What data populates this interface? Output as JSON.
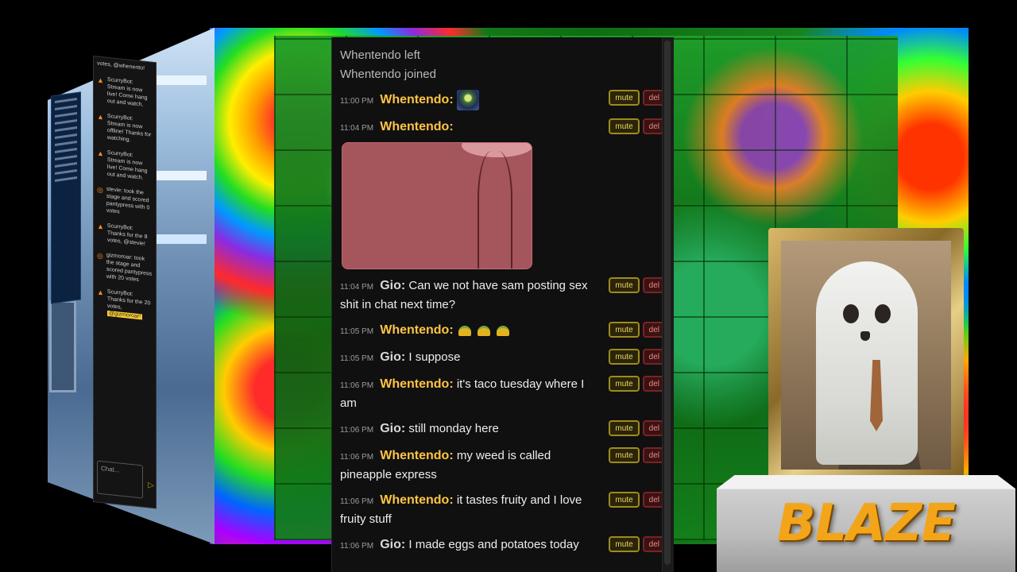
{
  "left_chat": {
    "items": [
      {
        "text": "votes, @whenento!"
      },
      {
        "text": "ScurryBot: Stream is now live! Come hang out and watch."
      },
      {
        "text": "ScurryBot: Stream is now offline! Thanks for watching."
      },
      {
        "text": "ScurryBot: Stream is now live! Come hang out and watch."
      },
      {
        "text": "stevie: took the stage and scored pantypress with 0 votes"
      },
      {
        "text": "ScurryBot: Thanks for the 8 votes, @stevie!"
      },
      {
        "text": "gizmoroar: took the stage and scored pantypress with 20 votes"
      },
      {
        "text": "ScurryBot: Thanks for the 20 votes,",
        "highlight": "@gizmoroar!"
      }
    ],
    "input_placeholder": "Chat..."
  },
  "chat": {
    "system_messages": [
      "Whentendo left",
      "Whentendo joined"
    ],
    "messages": [
      {
        "time": "11:00 PM",
        "user": "Whentendo:",
        "text": "",
        "emote": "emote-icon"
      },
      {
        "time": "11:04 PM",
        "user": "Whentendo:",
        "text": "",
        "image": "shared-image"
      },
      {
        "time": "11:04 PM",
        "user": "Gio:",
        "text": "Can we not have sam posting sex shit in chat next time?"
      },
      {
        "time": "11:05 PM",
        "user": "Whentendo:",
        "text": "",
        "tacos": 3
      },
      {
        "time": "11:05 PM",
        "user": "Gio:",
        "text": "I suppose"
      },
      {
        "time": "11:06 PM",
        "user": "Whentendo:",
        "text": "it's taco tuesday where I am"
      },
      {
        "time": "11:06 PM",
        "user": "Gio:",
        "text": "still monday here"
      },
      {
        "time": "11:06 PM",
        "user": "Whentendo:",
        "text": "my weed is called pineapple express"
      },
      {
        "time": "11:06 PM",
        "user": "Whentendo:",
        "text": "it tastes fruity and I love fruity stuff"
      },
      {
        "time": "11:06 PM",
        "user": "Gio:",
        "text": "I made eggs and potatoes today"
      }
    ],
    "mute_label": "mute",
    "del_label": "del"
  },
  "pedestal": {
    "label": "BLAZE"
  },
  "colors": {
    "accent_gold": "#ffc444",
    "mute": "#9f8a1f",
    "del": "#7a2323"
  }
}
